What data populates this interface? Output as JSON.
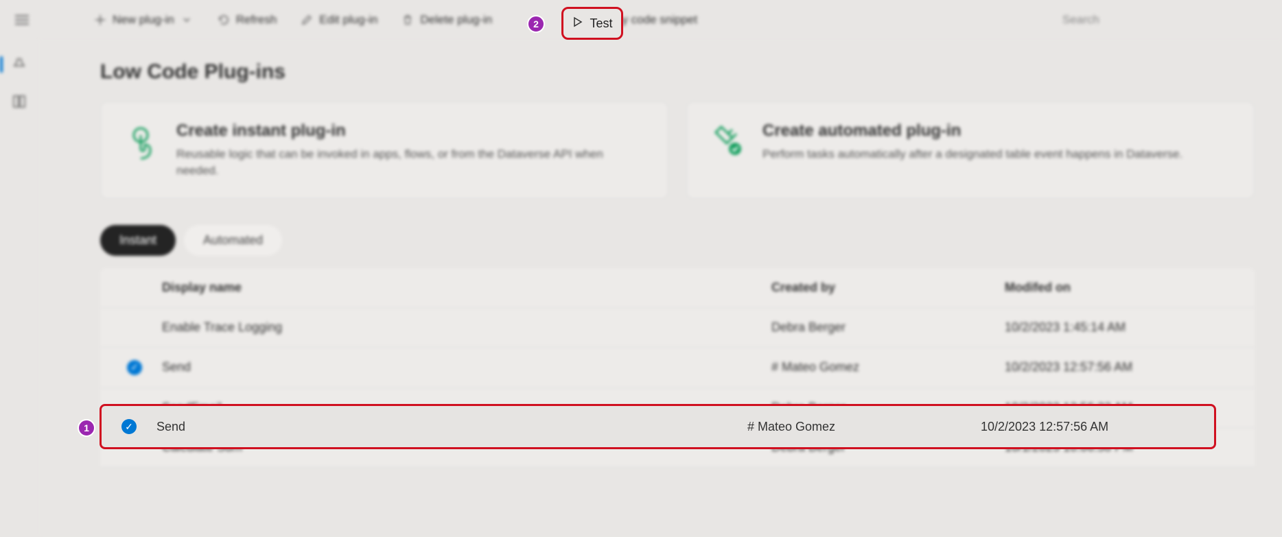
{
  "toolbar": {
    "new": "New plug-in",
    "refresh": "Refresh",
    "edit": "Edit plug-in",
    "delete": "Delete plug-in",
    "test": "Test",
    "copy": "Copy code snippet",
    "searchPlaceholder": "Search"
  },
  "page": {
    "title": "Low Code Plug-ins"
  },
  "cards": {
    "instant": {
      "title": "Create instant plug-in",
      "desc": "Reusable logic that can be invoked in apps, flows, or from the Dataverse API when needed."
    },
    "automated": {
      "title": "Create automated plug-in",
      "desc": "Perform tasks automatically after a designated table event happens in Dataverse."
    }
  },
  "tabs": {
    "instant": "Instant",
    "automated": "Automated"
  },
  "table": {
    "headers": {
      "name": "Display name",
      "createdBy": "Created by",
      "modifiedOn": "Modifed on"
    },
    "rows": [
      {
        "name": "Enable Trace Logging",
        "createdBy": "Debra Berger",
        "modifiedOn": "10/2/2023 1:45:14 AM",
        "selected": false
      },
      {
        "name": "Send",
        "createdBy": "# Mateo Gomez",
        "modifiedOn": "10/2/2023 12:57:56 AM",
        "selected": true
      },
      {
        "name": "SendEmail",
        "createdBy": "Debra Berger",
        "modifiedOn": "10/2/2023 12:56:32 AM",
        "selected": false
      },
      {
        "name": "Calculate Sum",
        "createdBy": "Debra Berger",
        "modifiedOn": "10/1/2023 10:06:58 PM",
        "selected": false
      }
    ]
  },
  "callouts": {
    "one": "1",
    "two": "2"
  }
}
